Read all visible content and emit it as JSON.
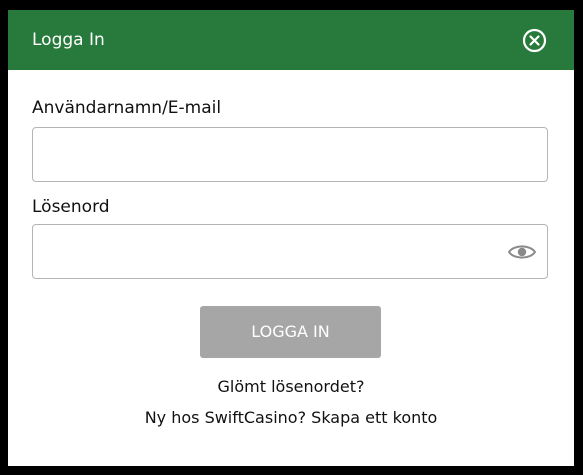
{
  "header": {
    "title": "Logga In",
    "close_icon": "close-circle-x-icon",
    "background_color": "#277a3b"
  },
  "form": {
    "username_label": "Användarnamn/E-mail",
    "username_value": "",
    "password_label": "Lösenord",
    "password_value": "",
    "password_toggle_icon": "eye-icon",
    "submit_label": "LOGGA IN",
    "submit_color": "#a6a6a6"
  },
  "links": {
    "forgot_password": "Glömt lösenordet?",
    "signup_prefix": "Ny hos SwiftCasino?",
    "signup_link": "Skapa ett konto"
  }
}
